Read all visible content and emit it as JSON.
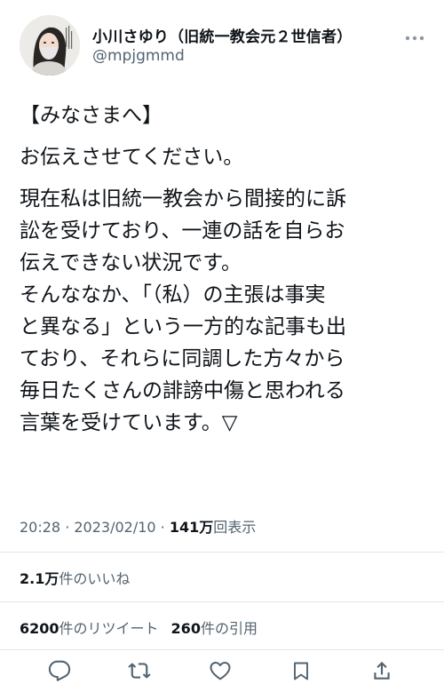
{
  "author": {
    "display_name": "小川さゆり（旧統一教会元２世信者）",
    "handle": "@mpjgmmd",
    "avatar_icon": "profile-photo-avatar"
  },
  "tweet": {
    "heading": "【みなさまへ】",
    "line2": "お伝えさせてください。",
    "body": "現在私は旧統一教会から間接的に訴\n訟を受けており、一連の話を自らお\n伝えできない状況です。\nそんななか、「（私）の主張は事実\nと異なる」という一方的な記事も出\nており、それらに同調した方々から\n毎日たくさんの誹謗中傷と思われる\n言葉を受けています。▽"
  },
  "meta": {
    "time": "20:28",
    "sep1": " · ",
    "date": "2023/02/10",
    "sep2": " · ",
    "views_count": "141万",
    "views_label": "回表示"
  },
  "stats": {
    "likes_count": "2.1万",
    "likes_label": "件のいいね",
    "retweets_count": "6200",
    "retweets_label": "件のリツイート",
    "quotes_count": "260",
    "quotes_label": "件の引用"
  },
  "actions": {
    "reply_icon": "reply-icon",
    "retweet_icon": "retweet-icon",
    "like_icon": "heart-icon",
    "bookmark_icon": "bookmark-icon",
    "share_icon": "share-icon"
  },
  "colors": {
    "text_primary": "#0f1419",
    "text_secondary": "#536471",
    "divider": "#e3e6e8",
    "icon": "#536471"
  }
}
